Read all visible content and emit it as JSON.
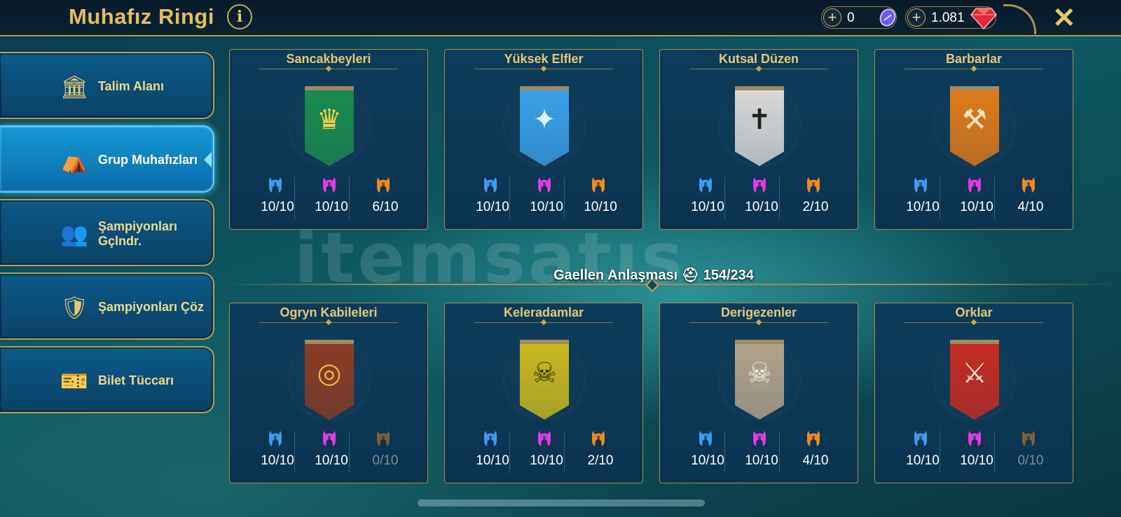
{
  "header": {
    "title": "Muhafız Ringi",
    "info_label": "i",
    "currency_1_value": "0",
    "currency_2_value": "1.081",
    "close_label": "✕"
  },
  "sidebar": {
    "items": [
      {
        "label": "Talim Alanı",
        "icon": "training-ground-icon",
        "active": false
      },
      {
        "label": "Grup Muhafızları",
        "icon": "faction-guardians-icon",
        "active": true
      },
      {
        "label": "Şampiyonları Gçlndr.",
        "icon": "champion-upgrade-icon",
        "active": false
      },
      {
        "label": "Şampiyonları Çöz",
        "icon": "champion-unlock-icon",
        "active": false
      },
      {
        "label": "Bilet Tüccarı",
        "icon": "ticket-merchant-icon",
        "active": false
      }
    ]
  },
  "divider_label": "Gaellen Anlaşması ⛑ 154/234",
  "watermark": "itemsatıs",
  "rarity_colors": {
    "rare": "#3f9bf0",
    "epic": "#e03ce0",
    "legendary": "#f08a1e"
  },
  "factions": [
    {
      "name": "Sancakbeyleri",
      "banner_color": "#1b8a4e",
      "glyph": "♛",
      "glyph_color": "#f3d04a",
      "rare": "10/10",
      "epic": "10/10",
      "legendary": "6/10"
    },
    {
      "name": "Yüksek Elfler",
      "banner_color": "#3aa0e6",
      "glyph": "✦",
      "glyph_color": "#dff3ff",
      "rare": "10/10",
      "epic": "10/10",
      "legendary": "10/10"
    },
    {
      "name": "Kutsal Düzen",
      "banner_color": "#d8d8d8",
      "glyph": "✝",
      "glyph_color": "#222222",
      "rare": "10/10",
      "epic": "10/10",
      "legendary": "2/10"
    },
    {
      "name": "Barbarlar",
      "banner_color": "#e07a1a",
      "glyph": "⚒",
      "glyph_color": "#f7e2b8",
      "rare": "10/10",
      "epic": "10/10",
      "legendary": "4/10"
    },
    {
      "name": "Ogryn Kabileleri",
      "banner_color": "#8a3b24",
      "glyph": "◎",
      "glyph_color": "#f0b23a",
      "rare": "10/10",
      "epic": "10/10",
      "legendary": "0/10"
    },
    {
      "name": "Keleradamlar",
      "banner_color": "#c9b91e",
      "glyph": "☠",
      "glyph_color": "#3a3300",
      "rare": "10/10",
      "epic": "10/10",
      "legendary": "2/10"
    },
    {
      "name": "Derigezenler",
      "banner_color": "#b4a48c",
      "glyph": "☠",
      "glyph_color": "#f0ece0",
      "rare": "10/10",
      "epic": "10/10",
      "legendary": "4/10"
    },
    {
      "name": "Orklar",
      "banner_color": "#c62b22",
      "glyph": "⚔",
      "glyph_color": "#f6e6d8",
      "rare": "10/10",
      "epic": "10/10",
      "legendary": "0/10"
    }
  ]
}
